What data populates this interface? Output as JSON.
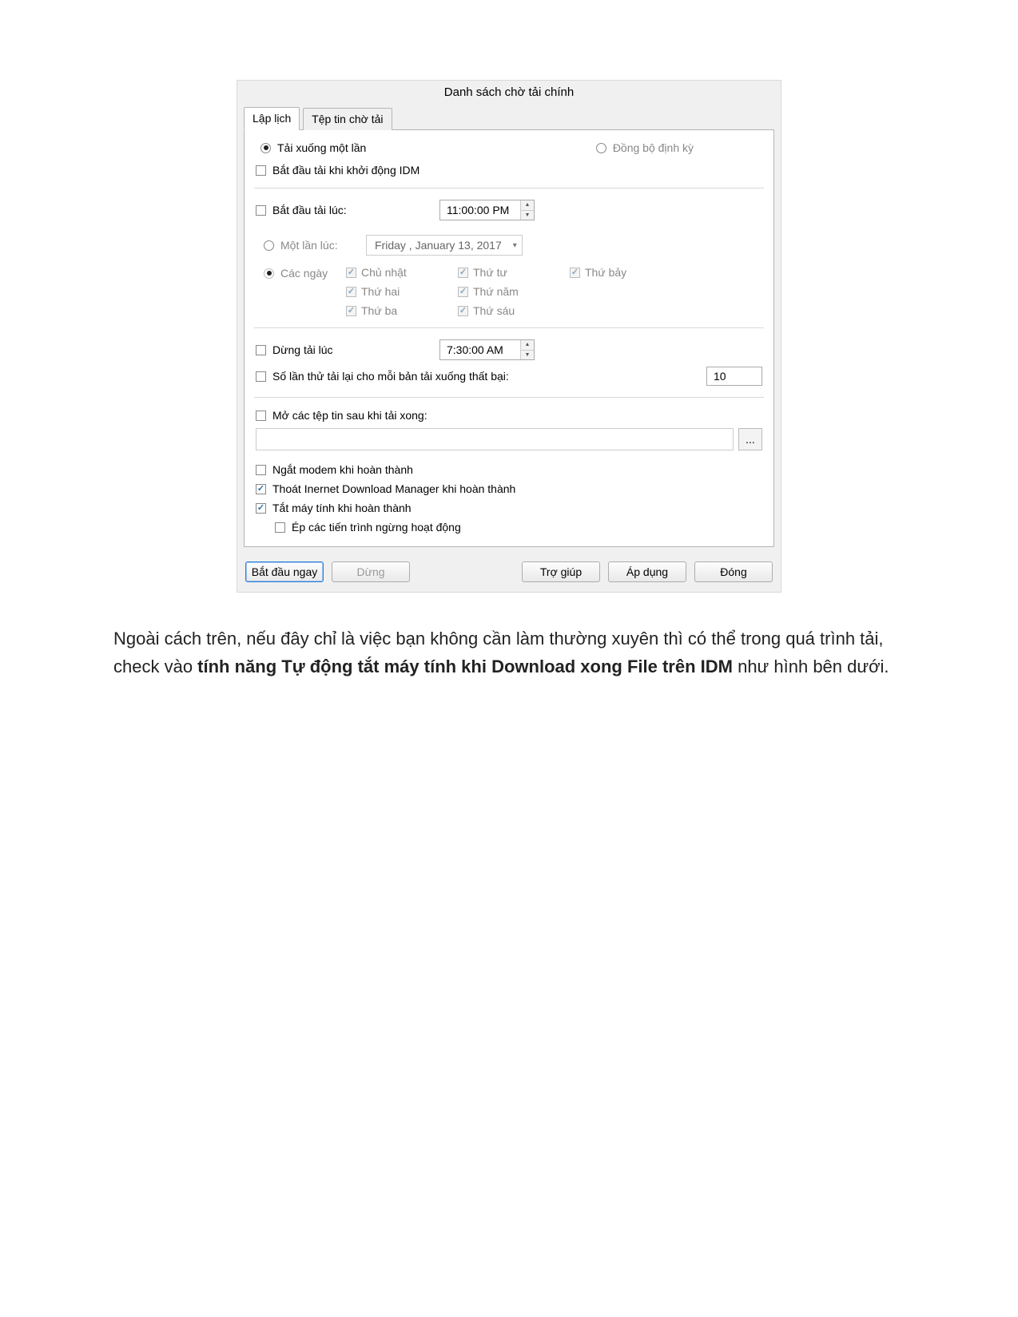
{
  "dialog": {
    "title": "Danh sách chờ tải chính",
    "tabs": {
      "schedule": "Lập lịch",
      "queue": "Tệp tin chờ tải"
    },
    "mode": {
      "one_time": "Tải xuống một lần",
      "periodic": "Đồng bộ định kỳ"
    },
    "start_on_idm": "Bắt đầu tải khi khởi động IDM",
    "start_at": {
      "label": "Bắt đầu tải lúc:",
      "time": "11:00:00 PM"
    },
    "one_shot": {
      "label": "Một lần lúc:",
      "date": "Friday , January 13, 2017"
    },
    "daily": {
      "label": "Các ngày",
      "days": {
        "sun": "Chủ nhật",
        "mon": "Thứ hai",
        "tue": "Thứ ba",
        "wed": "Thứ tư",
        "thu": "Thứ năm",
        "fri": "Thứ sáu",
        "sat": "Thứ bảy"
      }
    },
    "stop_at": {
      "label": "Dừng tải lúc",
      "time": "7:30:00 AM"
    },
    "retries": {
      "label": "Số lần thử tải lại cho mỗi bản tải xuống thất bại:",
      "value": "10"
    },
    "open_after": "Mở các tệp tin sau khi tải xong:",
    "hangup": "Ngắt modem khi hoàn thành",
    "exit_idm": "Thoát Inernet Download Manager khi hoàn thành",
    "shutdown": "Tắt máy tính khi hoàn thành",
    "force_stop": "Ép các tiến trình ngừng hoạt động",
    "buttons": {
      "start_now": "Bắt đầu ngay",
      "stop": "Dừng",
      "help": "Trợ giúp",
      "apply": "Áp dụng",
      "close": "Đóng"
    },
    "browse": "..."
  },
  "caption": {
    "pre": "Ngoài cách trên, nếu đây chỉ là việc bạn không cần làm thường xuyên thì có thể trong quá trình tải, check vào ",
    "bold": "tính năng Tự động tắt máy tính khi Download xong File trên IDM",
    "post": " như hình bên dưới."
  }
}
